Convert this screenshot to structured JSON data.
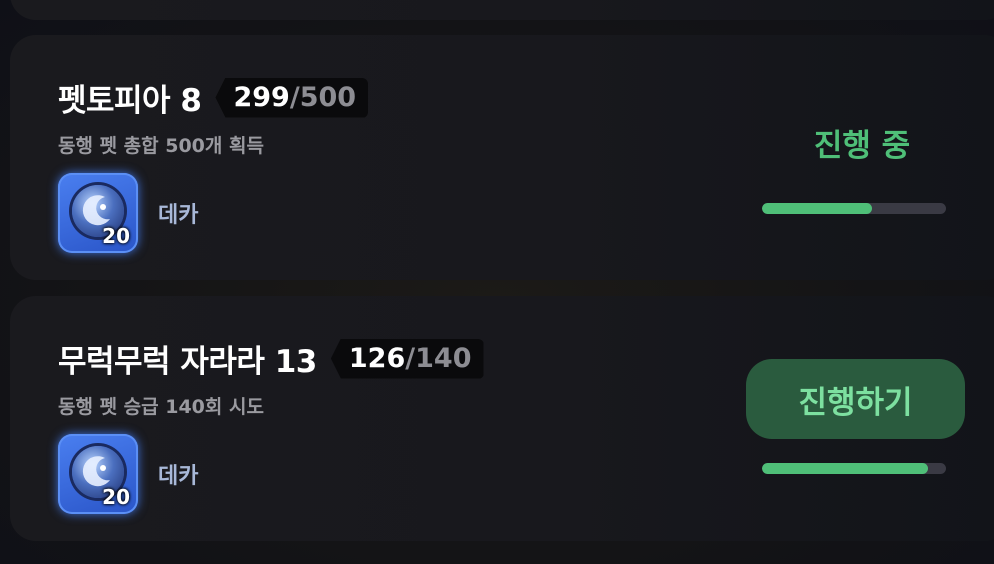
{
  "quests": [
    {
      "title": "펫토피아 8",
      "progress_current": "299",
      "progress_sep": "/",
      "progress_max": "500",
      "progress_ratio": 0.598,
      "description": "동행 펫 총합 500개 획득",
      "reward_name": "데카",
      "reward_qty": "20",
      "status_label": "진행 중"
    },
    {
      "title": "무럭무럭 자라라 13",
      "progress_current": "126",
      "progress_sep": "/",
      "progress_max": "140",
      "progress_ratio": 0.9,
      "description": "동행 펫 승급 140회 시도",
      "reward_name": "데카",
      "reward_qty": "20",
      "action_label": "진행하기"
    }
  ],
  "colors": {
    "accent_green": "#4fbf78",
    "button_bg": "#2a5b3e",
    "reward_blue": "#3d6fe0"
  },
  "icons": {
    "reward": "deka-coin-icon"
  }
}
